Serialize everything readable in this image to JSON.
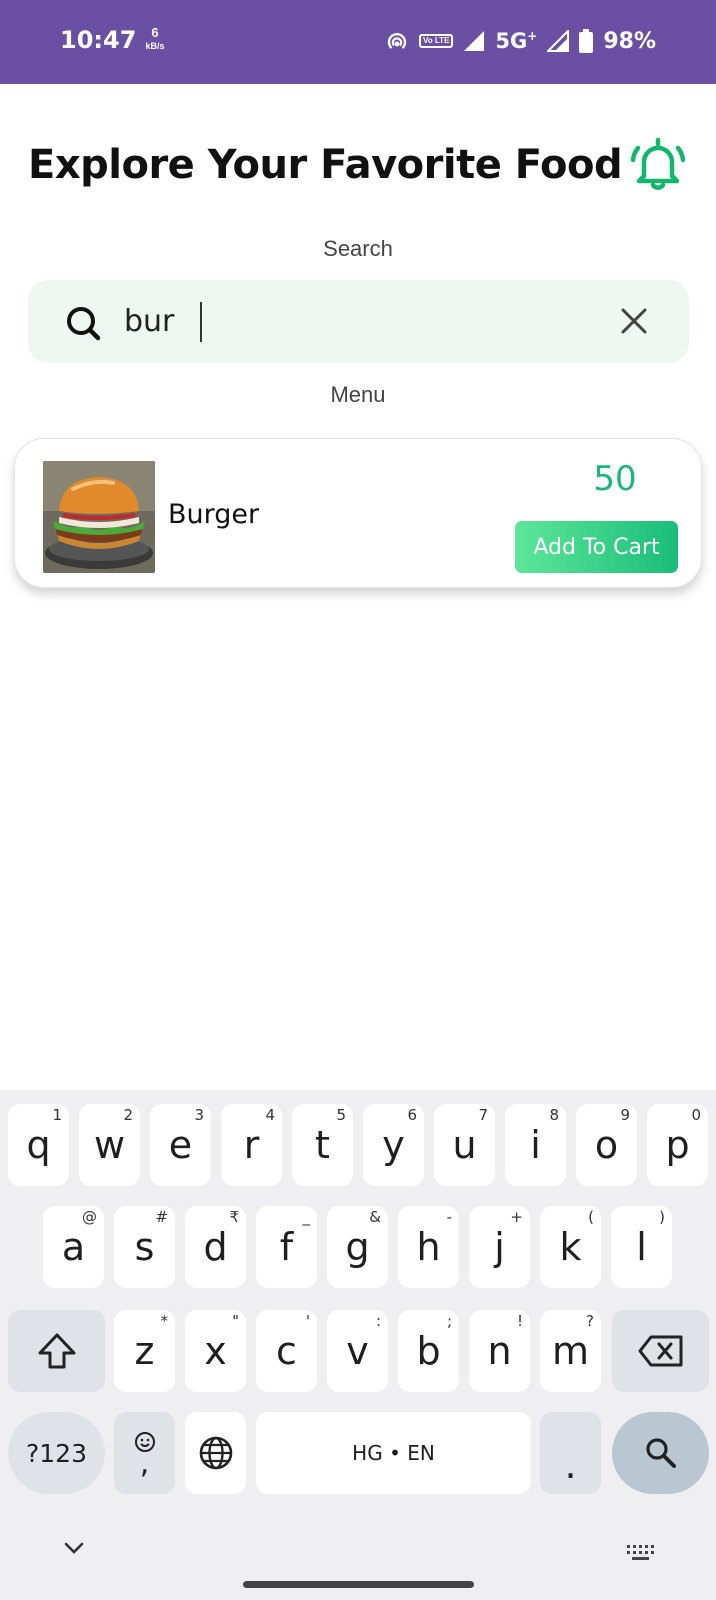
{
  "status_bar": {
    "time": "10:47",
    "net_speed_value": "6",
    "net_speed_unit": "kB/s",
    "volte_label": "Vo LTE",
    "network": "5G",
    "network_sup": "+",
    "battery": "98%",
    "bg_color": "#6a4fa3"
  },
  "header": {
    "title": "Explore Your Favorite Food",
    "bell_icon": "bell-icon",
    "accent_color": "#1fb67a"
  },
  "search": {
    "label": "Search",
    "value": "bur",
    "search_icon": "search-icon",
    "clear_icon": "close-icon"
  },
  "menu": {
    "label": "Menu",
    "items": [
      {
        "name": "Burger",
        "price": "50",
        "add_label": "Add To Cart"
      }
    ]
  },
  "keyboard": {
    "row1": [
      {
        "k": "q",
        "h": "1"
      },
      {
        "k": "w",
        "h": "2"
      },
      {
        "k": "e",
        "h": "3"
      },
      {
        "k": "r",
        "h": "4"
      },
      {
        "k": "t",
        "h": "5"
      },
      {
        "k": "y",
        "h": "6"
      },
      {
        "k": "u",
        "h": "7"
      },
      {
        "k": "i",
        "h": "8"
      },
      {
        "k": "o",
        "h": "9"
      },
      {
        "k": "p",
        "h": "0"
      }
    ],
    "row2": [
      {
        "k": "a",
        "h": "@"
      },
      {
        "k": "s",
        "h": "#"
      },
      {
        "k": "d",
        "h": "₹"
      },
      {
        "k": "f",
        "h": "_"
      },
      {
        "k": "g",
        "h": "&"
      },
      {
        "k": "h",
        "h": "-"
      },
      {
        "k": "j",
        "h": "+"
      },
      {
        "k": "k",
        "h": "("
      },
      {
        "k": "l",
        "h": ")"
      }
    ],
    "row3": [
      {
        "k": "z",
        "h": "*"
      },
      {
        "k": "x",
        "h": "\""
      },
      {
        "k": "c",
        "h": "'"
      },
      {
        "k": "v",
        "h": ":"
      },
      {
        "k": "b",
        "h": ";"
      },
      {
        "k": "n",
        "h": "!"
      },
      {
        "k": "m",
        "h": "?"
      }
    ],
    "symbols_key": "?123",
    "comma_key": ",",
    "space_label": "HG • EN",
    "period_key": ".",
    "shift_icon": "shift-icon",
    "backspace_icon": "backspace-icon",
    "emoji_icon": "emoji-icon",
    "globe_icon": "globe-icon",
    "search_key_icon": "search-icon"
  }
}
